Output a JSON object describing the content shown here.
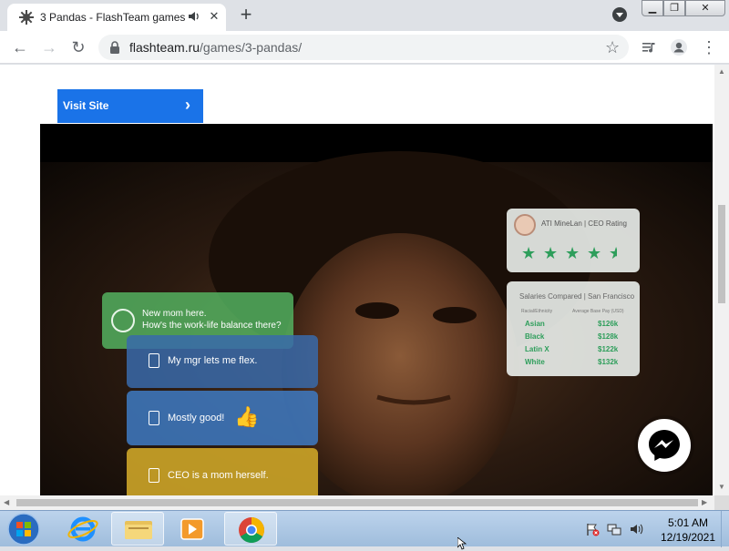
{
  "browser": {
    "tab_title": "3 Pandas - FlashTeam games",
    "url_host": "flashteam.ru",
    "url_path": "/games/3-pandas/"
  },
  "page": {
    "visit_site_label": "Visit Site",
    "chat": {
      "green_line1": "New mom here.",
      "green_line2": "How's the work-life balance there?",
      "blue1": "My mgr lets me flex.",
      "blue2": "Mostly good!",
      "yellow": "CEO is a mom herself."
    },
    "rating_card": {
      "title": "ATI MineLan | CEO Rating",
      "rating": 4.5,
      "max": 5
    },
    "salary_card": {
      "title": "Salaries Compared | San Francisco",
      "head_left": "Racial/Ethnicity",
      "head_right": "Average Base Pay (USD)",
      "rows": [
        {
          "label": "Asian",
          "value": "$126k"
        },
        {
          "label": "Black",
          "value": "$128k"
        },
        {
          "label": "Latin X",
          "value": "$122k"
        },
        {
          "label": "White",
          "value": "$132k"
        }
      ]
    }
  },
  "taskbar": {
    "time": "5:01 AM",
    "date": "12/19/2021"
  },
  "colors": {
    "accent": "#1a73e8",
    "chat_green": "#54b05f",
    "chat_blue": "#3e78be",
    "chat_yellow": "#cda528",
    "star_green": "#2e9e5b"
  }
}
